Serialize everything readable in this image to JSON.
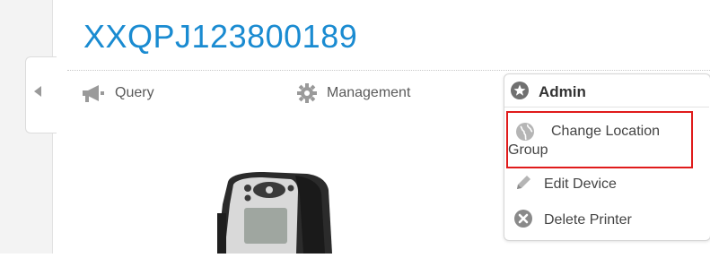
{
  "title": "XXQPJ123800189",
  "toolbar": {
    "query_label": "Query",
    "management_label": "Management"
  },
  "menu": {
    "header_label": "Admin",
    "items": [
      {
        "label": "Change Location Group",
        "icon": "globe-icon",
        "highlighted": true
      },
      {
        "label": "Edit Device",
        "icon": "pencil-icon"
      },
      {
        "label": "Delete Printer",
        "icon": "x-circle-icon"
      }
    ]
  },
  "colors": {
    "title": "#1a8bd1",
    "highlight_border": "#e01b1b",
    "icon_gray": "#8a8a8a"
  }
}
